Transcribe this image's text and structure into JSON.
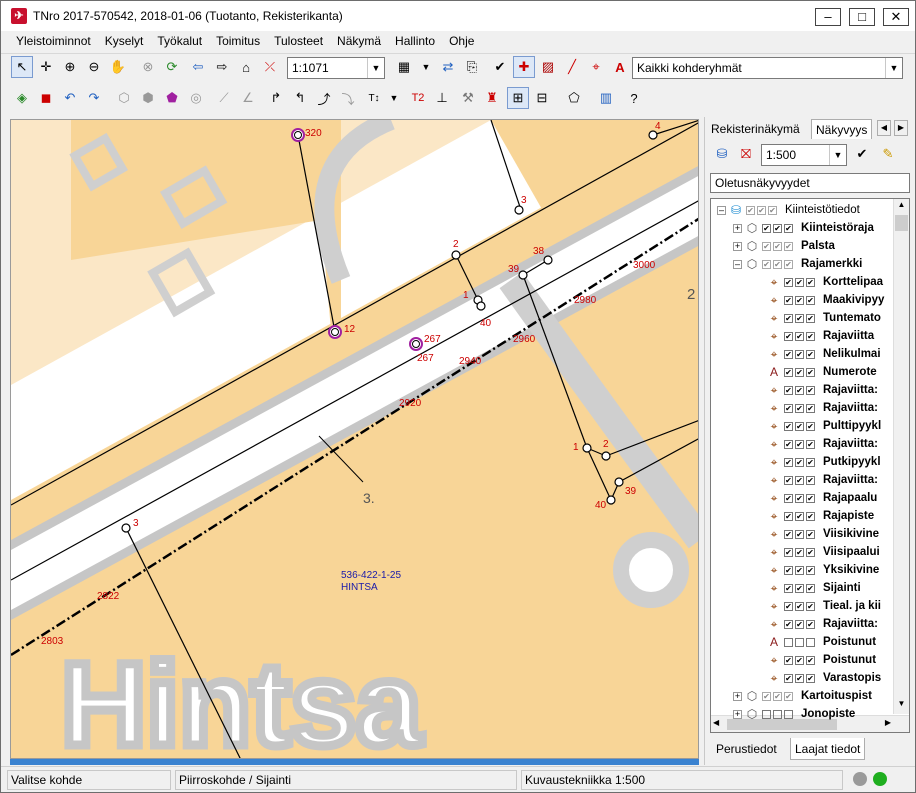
{
  "window": {
    "title": "TNro 2017-570542, 2018-01-06 (Tuotanto, Rekisterikanta)",
    "minimize": "–",
    "maximize": "□",
    "close": "✕"
  },
  "menu": [
    "Yleistoiminnot",
    "Kyselyt",
    "Työkalut",
    "Toimitus",
    "Tulosteet",
    "Näkymä",
    "Hallinto",
    "Ohje"
  ],
  "toolbar": {
    "scale": "1:1071",
    "target_group": "Kaikki kohderyhmät",
    "t2_label": "T2"
  },
  "map": {
    "point_labels": {
      "p320": "320",
      "p4": "4",
      "p3": "3",
      "p2": "2",
      "p38": "38",
      "p39": "39",
      "p3000": "3000",
      "p1": "1",
      "p2980": "2980",
      "p12": "12",
      "p267a": "267",
      "p267b": "267",
      "p40": "40",
      "p2960": "2960",
      "p2940": "2940",
      "p2920": "2920",
      "p1b": "1",
      "p2b": "2",
      "p39b": "39",
      "p40b": "40",
      "p3b": "3",
      "p2822": "2822",
      "p2803": "2803"
    },
    "big_number": "2",
    "block_number": "3.",
    "parcel_id": "536-422-1-25",
    "parcel_name": "HINTSA",
    "background_text": "Hintsa"
  },
  "right_panel": {
    "tab_registry": "Rekisterinäkymä",
    "tab_visibility": "Näkyvyys",
    "scale": "1:500",
    "default_view": "Oletusnäkyvyydet",
    "tree": [
      {
        "label": "Kiinteistötiedot",
        "level": 0,
        "expander": "–",
        "icon": "database-icon",
        "checks": "gray",
        "bold": false
      },
      {
        "label": "Kiinteistöraja",
        "level": 1,
        "expander": "+",
        "icon": "layer-icon",
        "checks": "on",
        "bold": true
      },
      {
        "label": "Palsta",
        "level": 1,
        "expander": "+",
        "icon": "layer-icon",
        "checks": "gray",
        "bold": true
      },
      {
        "label": "Rajamerkki",
        "level": 1,
        "expander": "–",
        "icon": "layer-icon",
        "checks": "gray",
        "bold": true
      },
      {
        "label": "Korttelipaa",
        "level": 2,
        "icon": "crosshair-icon",
        "checks": "on",
        "bold": true
      },
      {
        "label": "Maakivipyy",
        "level": 2,
        "icon": "crosshair-icon",
        "checks": "on",
        "bold": true
      },
      {
        "label": "Tuntemato",
        "level": 2,
        "icon": "crosshair-icon",
        "checks": "on",
        "bold": true
      },
      {
        "label": "Rajaviitta",
        "level": 2,
        "icon": "crosshair-icon",
        "checks": "on",
        "bold": true
      },
      {
        "label": "Nelikulmai",
        "level": 2,
        "icon": "crosshair-icon",
        "checks": "on",
        "bold": true
      },
      {
        "label": "Numerote",
        "level": 2,
        "icon": "text-icon",
        "checks": "on",
        "bold": true
      },
      {
        "label": "Rajaviitta: ",
        "level": 2,
        "icon": "crosshair-icon",
        "checks": "on",
        "bold": true
      },
      {
        "label": "Rajaviitta: ",
        "level": 2,
        "icon": "crosshair-icon",
        "checks": "on",
        "bold": true
      },
      {
        "label": "Pulttipyykl",
        "level": 2,
        "icon": "crosshair-icon",
        "checks": "on",
        "bold": true
      },
      {
        "label": "Rajaviitta: ",
        "level": 2,
        "icon": "crosshair-icon",
        "checks": "on",
        "bold": true
      },
      {
        "label": "Putkipyykl",
        "level": 2,
        "icon": "crosshair-icon",
        "checks": "on",
        "bold": true
      },
      {
        "label": "Rajaviitta: ",
        "level": 2,
        "icon": "crosshair-icon",
        "checks": "on",
        "bold": true
      },
      {
        "label": "Rajapaalu",
        "level": 2,
        "icon": "crosshair-icon",
        "checks": "on",
        "bold": true
      },
      {
        "label": "Rajapiste",
        "level": 2,
        "icon": "crosshair-icon",
        "checks": "on",
        "bold": true
      },
      {
        "label": "Viisikivine",
        "level": 2,
        "icon": "crosshair-icon",
        "checks": "on",
        "bold": true
      },
      {
        "label": "Viisipaalui",
        "level": 2,
        "icon": "crosshair-icon",
        "checks": "on",
        "bold": true
      },
      {
        "label": "Yksikivine",
        "level": 2,
        "icon": "crosshair-icon",
        "checks": "on",
        "bold": true
      },
      {
        "label": "Sijainti",
        "level": 2,
        "icon": "crosshair-icon",
        "checks": "on",
        "bold": true
      },
      {
        "label": "Tieal. ja kii",
        "level": 2,
        "icon": "crosshair-icon",
        "checks": "on",
        "bold": true
      },
      {
        "label": "Rajaviitta: ",
        "level": 2,
        "icon": "crosshair-icon",
        "checks": "on",
        "bold": true
      },
      {
        "label": "Poistunut",
        "level": 2,
        "icon": "text-icon",
        "checks": "off",
        "bold": true
      },
      {
        "label": "Poistunut",
        "level": 2,
        "icon": "crosshair-icon",
        "checks": "on",
        "bold": true
      },
      {
        "label": "Varastopis",
        "level": 2,
        "icon": "crosshair-icon",
        "checks": "on",
        "bold": true
      },
      {
        "label": "Kartoituspist",
        "level": 1,
        "expander": "+",
        "icon": "layer-icon",
        "checks": "gray",
        "bold": true
      },
      {
        "label": "Jonopiste",
        "level": 1,
        "expander": "+",
        "icon": "layer-icon",
        "checks": "off",
        "bold": true
      }
    ],
    "bottom_tab_basic": "Perustiedot",
    "bottom_tab_extended": "Laajat tiedot"
  },
  "status": {
    "left": "Valitse kohde",
    "middle": "Piirroskohde / Sijainti",
    "right": "Kuvaustekniikka 1:500"
  },
  "colors": {
    "parcel_fill": "#f8d597",
    "road_fill": "#ffffff",
    "gray_overlay": "#c6c6c6",
    "label_red": "#cc0000",
    "label_blue": "#1a1aaa",
    "highlight_ring": "#a020a0"
  }
}
